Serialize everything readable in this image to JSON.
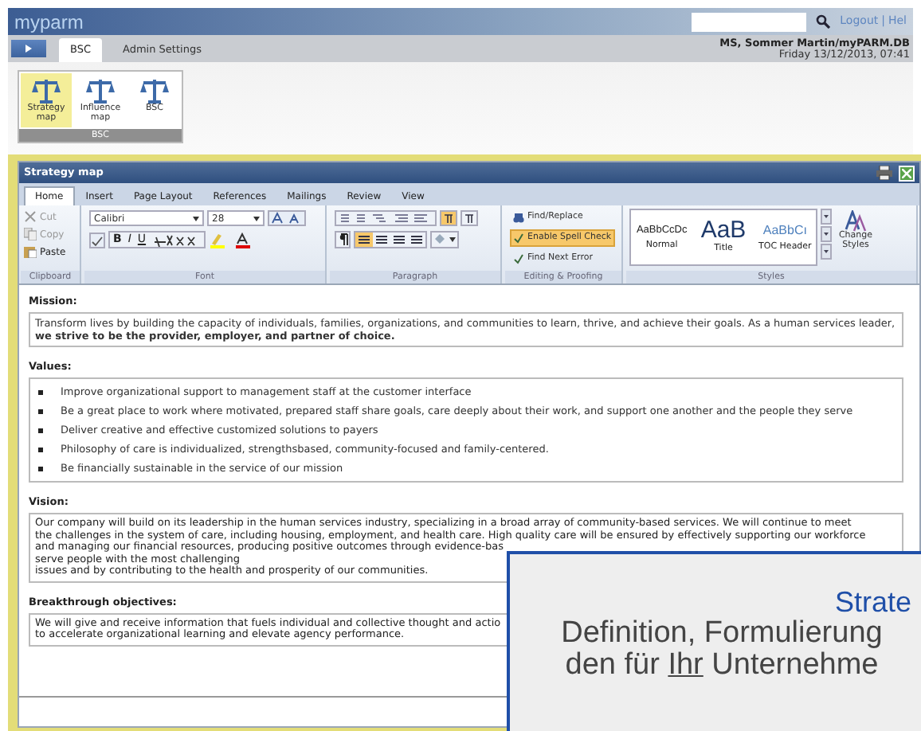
{
  "header": {
    "logo": "myparm",
    "links": [
      "Logout",
      "Hel"
    ],
    "separator": "|"
  },
  "nav": {
    "tabs": [
      {
        "label": "BSC",
        "selected": true
      },
      {
        "label": "Admin Settings",
        "selected": false
      }
    ],
    "user": "MS, Sommer Martin/myPARM.DB",
    "datetime": "Friday 13/12/2013, 07:41"
  },
  "module_ribbon": {
    "group": "BSC",
    "buttons": [
      {
        "label": "Strategy map",
        "selected": true
      },
      {
        "label": "Influence map",
        "selected": false
      },
      {
        "label": "BSC",
        "selected": false
      }
    ]
  },
  "window": {
    "title": "Strategy map"
  },
  "editor_tabs": [
    {
      "label": "Home",
      "selected": true
    },
    {
      "label": "Insert",
      "selected": false
    },
    {
      "label": "Page Layout",
      "selected": false
    },
    {
      "label": "References",
      "selected": false
    },
    {
      "label": "Mailings",
      "selected": false
    },
    {
      "label": "Review",
      "selected": false
    },
    {
      "label": "View",
      "selected": false
    }
  ],
  "ribbon": {
    "clipboard": {
      "label": "Clipboard",
      "buttons": [
        {
          "label": "Cut",
          "disabled": true
        },
        {
          "label": "Copy",
          "disabled": true
        },
        {
          "label": "Paste",
          "disabled": false
        }
      ]
    },
    "font": {
      "label": "Font",
      "family": "Calibri",
      "size": "28",
      "format_buttons": [
        "B",
        "I",
        "U"
      ]
    },
    "paragraph": {
      "label": "Paragraph",
      "alignment": [
        {
          "selected": true
        },
        {
          "selected": false
        },
        {
          "selected": false
        },
        {
          "selected": false
        }
      ],
      "direction": [
        {
          "selected": true
        },
        {
          "selected": false
        }
      ]
    },
    "editing": {
      "label": "Editing & Proofing",
      "buttons": [
        {
          "label": "Find/Replace",
          "selected": false
        },
        {
          "label": "Enable Spell Check",
          "selected": true
        },
        {
          "label": "Find Next Error",
          "selected": false
        }
      ]
    },
    "styles": {
      "label": "Styles",
      "items": [
        {
          "sample": "AaBbCcDc",
          "name": "Normal",
          "kind": "normal"
        },
        {
          "sample": "AaB",
          "name": "Title",
          "kind": "title"
        },
        {
          "sample": "AaBbCı",
          "name": "TOC Header",
          "kind": "toc"
        }
      ],
      "change": "Change Styles"
    }
  },
  "sections": [
    {
      "heading": "Mission:",
      "kind": "paragraph",
      "text": "Transform lives by building the capacity of individuals, families, organizations, and communities to learn, thrive, and achieve their goals. As a human services leader, **we strive to be the provider, employer, and partner of choice.**"
    },
    {
      "heading": "Values:",
      "kind": "list",
      "items": [
        "Improve organizational support to management staff at the customer interface",
        "Be a great place to work where motivated, prepared staff share goals, care deeply about their work, and support one another and the people they serve",
        "Deliver creative and effective customized solutions to payers",
        "Philosophy of care is individualized, strengthsbased, community-focused and family-centered.",
        "Be financially sustainable in the service of our mission"
      ]
    },
    {
      "heading": "Vision:",
      "kind": "lines",
      "lines": [
        "Our company will build on its leadership in the human services industry, specializing in a broad array of community-based services. We will continue to meet",
        "the challenges in the system of care, including housing, employment, and health care. High quality care will be ensured by effectively supporting our workforce",
        "and managing our financial resources, producing positive outcomes through evidence-bas",
        "serve people with the most challenging",
        "issues and by contributing to the health and prosperity of our communities."
      ]
    },
    {
      "heading": "Breakthrough objectives:",
      "kind": "lines",
      "lines": [
        "We will give and receive information that fuels individual and collective thought and actio",
        "to accelerate organizational learning and elevate agency performance."
      ]
    }
  ],
  "overlay": {
    "title": "Strate",
    "lines": [
      [
        {
          "text": "Definition, Formulierung",
          "underline": false
        }
      ],
      [
        {
          "text": "den für ",
          "underline": false
        },
        {
          "text": "Ihr",
          "underline": true
        },
        {
          "text": " Unternehme",
          "underline": false
        }
      ]
    ]
  }
}
